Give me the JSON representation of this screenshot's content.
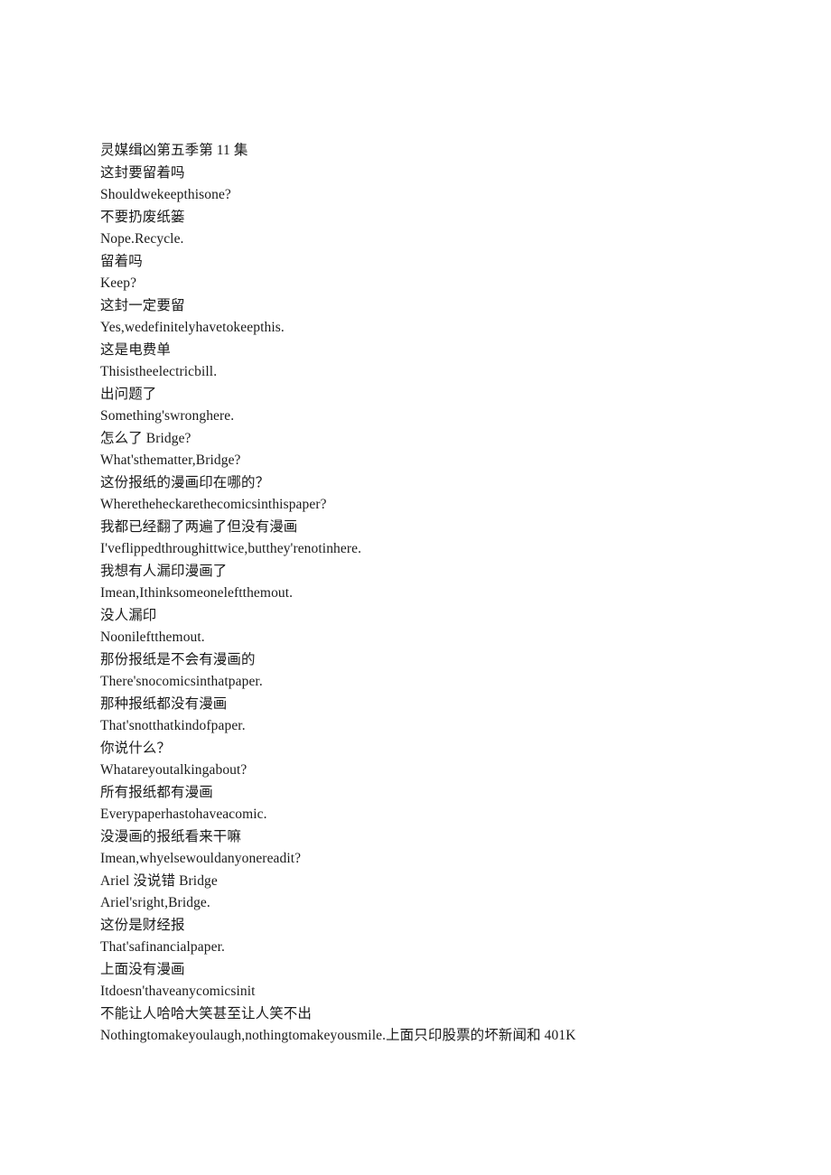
{
  "document": {
    "title": "灵媒缉凶第五季第 11 集",
    "page_background": "#ffffff",
    "text_color": "#1a1a1a",
    "lines": [
      {
        "id": "l1",
        "lang": "cn",
        "text": "灵媒缉凶第五季第 11 集"
      },
      {
        "id": "l2",
        "lang": "cn",
        "text": "这封要留着吗"
      },
      {
        "id": "l3",
        "lang": "en",
        "text": "Shouldwekeepthisone?"
      },
      {
        "id": "l4",
        "lang": "cn",
        "text": "不要扔废纸篓"
      },
      {
        "id": "l5",
        "lang": "en",
        "text": "Nope.Recycle."
      },
      {
        "id": "l6",
        "lang": "cn",
        "text": "留着吗"
      },
      {
        "id": "l7",
        "lang": "en",
        "text": "Keep?"
      },
      {
        "id": "l8",
        "lang": "cn",
        "text": "这封一定要留"
      },
      {
        "id": "l9",
        "lang": "en",
        "text": "Yes,wedefinitelyhavetokeepthis."
      },
      {
        "id": "l10",
        "lang": "cn",
        "text": "这是电费单"
      },
      {
        "id": "l11",
        "lang": "en",
        "text": "Thisistheelectricbill."
      },
      {
        "id": "l12",
        "lang": "cn",
        "text": "出问题了"
      },
      {
        "id": "l13",
        "lang": "en",
        "text": "Something'swronghere."
      },
      {
        "id": "l14",
        "lang": "cn",
        "text": "怎么了 Bridge?"
      },
      {
        "id": "l15",
        "lang": "en",
        "text": "What'sthematter,Bridge?"
      },
      {
        "id": "l16",
        "lang": "cn",
        "text": "这份报纸的漫画印在哪的？"
      },
      {
        "id": "l17",
        "lang": "en",
        "text": "Wheretheheckarethecomicsinthispaper?"
      },
      {
        "id": "l18",
        "lang": "cn",
        "text": "我都已经翻了两遍了但没有漫画"
      },
      {
        "id": "l19",
        "lang": "en",
        "text": "I'veflippedthroughittwice,butthey'renotinhere."
      },
      {
        "id": "l20",
        "lang": "cn",
        "text": "我想有人漏印漫画了"
      },
      {
        "id": "l21",
        "lang": "en",
        "text": "Imean,Ithinksomeoneleftthemout."
      },
      {
        "id": "l22",
        "lang": "cn",
        "text": "没人漏印"
      },
      {
        "id": "l23",
        "lang": "en",
        "text": "Noonileftthemout."
      },
      {
        "id": "l24",
        "lang": "cn",
        "text": "那份报纸是不会有漫画的"
      },
      {
        "id": "l25",
        "lang": "en",
        "text": "There'snocomicsinthatpaper."
      },
      {
        "id": "l26",
        "lang": "cn",
        "text": "那种报纸都没有漫画"
      },
      {
        "id": "l27",
        "lang": "en",
        "text": "That'snotthatkindofpaper."
      },
      {
        "id": "l28",
        "lang": "cn",
        "text": "你说什么？"
      },
      {
        "id": "l29",
        "lang": "en",
        "text": "Whatareyoutalkingabout?"
      },
      {
        "id": "l30",
        "lang": "cn",
        "text": "所有报纸都有漫画"
      },
      {
        "id": "l31",
        "lang": "en",
        "text": "Everypaperhastohaveacomic."
      },
      {
        "id": "l32",
        "lang": "cn",
        "text": "没漫画的报纸看来干嘛"
      },
      {
        "id": "l33",
        "lang": "en",
        "text": "Imean,whyelsewouldanyonereadit?"
      },
      {
        "id": "l34",
        "lang": "cn",
        "text": "Ariel 没说错 Bridge"
      },
      {
        "id": "l35",
        "lang": "en",
        "text": "Ariel'sright,Bridge."
      },
      {
        "id": "l36",
        "lang": "cn",
        "text": "这份是财经报"
      },
      {
        "id": "l37",
        "lang": "en",
        "text": "That'safinancialpaper."
      },
      {
        "id": "l38",
        "lang": "cn",
        "text": "上面没有漫画"
      },
      {
        "id": "l39",
        "lang": "en",
        "text": "Itdoesn'thaveanycomicsinit"
      },
      {
        "id": "l40",
        "lang": "cn",
        "text": "不能让人哈哈大笑甚至让人笑不出"
      },
      {
        "id": "l41",
        "lang": "en",
        "text": "Nothingtomakeyoulaugh,nothingtomakeyousmile.上面只印股票的坏新闻和 401K"
      }
    ]
  }
}
